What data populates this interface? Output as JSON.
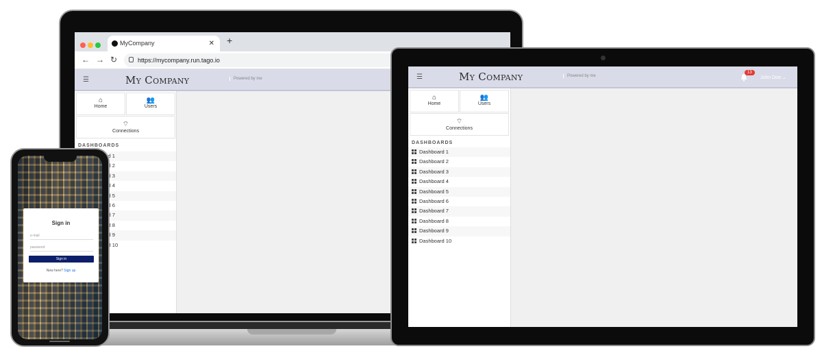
{
  "browser": {
    "tab_title": "MyCompany",
    "url": "https://mycompany.run.tago.io"
  },
  "app": {
    "brand": "My Company",
    "powered_by": "Powered by me",
    "user_name": "John Doe",
    "notification_count": "13",
    "nav": {
      "home": "Home",
      "users": "Users",
      "connections": "Connections"
    },
    "dashboards_label": "DASHBOARDS",
    "dashboards": [
      "Dashboard 1",
      "Dashboard 2",
      "Dashboard 3",
      "Dashboard 4",
      "Dashboard 5",
      "Dashboard 6",
      "Dashboard 7",
      "Dashboard 8",
      "Dashboard 9",
      "Dashboard 10"
    ],
    "colors": {
      "header": "#d9dbe8",
      "signin_button": "#0d1f6a",
      "badge": "#e53935"
    }
  },
  "signin": {
    "title": "Sign in",
    "email_placeholder": "e-mail",
    "password_placeholder": "password",
    "button": "Sign in",
    "new_here": "New here?",
    "signup": "Sign up"
  },
  "icons": {
    "menu": "hamburger-icon",
    "home": "home-icon",
    "users": "users-icon",
    "connections": "wifi-icon",
    "dashboard": "grid-icon",
    "bell": "bell-icon"
  }
}
